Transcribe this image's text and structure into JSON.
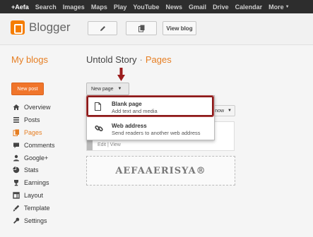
{
  "gbar": {
    "items": [
      "+Aefa",
      "Search",
      "Images",
      "Maps",
      "Play",
      "YouTube",
      "News",
      "Gmail",
      "Drive",
      "Calendar"
    ],
    "more": "More"
  },
  "header": {
    "logo_text": "Blogger",
    "view_blog": "View blog"
  },
  "sidebar": {
    "title": "My blogs",
    "new_post": "New post",
    "items": [
      {
        "label": "Overview",
        "icon": "overview-icon"
      },
      {
        "label": "Posts",
        "icon": "posts-icon"
      },
      {
        "label": "Pages",
        "icon": "pages-icon",
        "active": true
      },
      {
        "label": "Comments",
        "icon": "comments-icon"
      },
      {
        "label": "Google+",
        "icon": "google-plus-icon"
      },
      {
        "label": "Stats",
        "icon": "stats-icon"
      },
      {
        "label": "Earnings",
        "icon": "earnings-icon"
      },
      {
        "label": "Layout",
        "icon": "layout-icon"
      },
      {
        "label": "Template",
        "icon": "template-icon"
      },
      {
        "label": "Settings",
        "icon": "settings-icon"
      }
    ]
  },
  "main": {
    "blog_name": "Untold Story",
    "separator": "·",
    "current": "Pages",
    "new_page": "New page",
    "show_label": "now",
    "page_links": "Edit | View",
    "gadget_text": "AEFAAERISYA®"
  },
  "dropdown": {
    "items": [
      {
        "title": "Blank page",
        "subtitle": "Add text and media"
      },
      {
        "title": "Web address",
        "subtitle": "Send readers to another web address"
      }
    ]
  },
  "colors": {
    "accent": "#e67e22",
    "highlight": "#8b1a1a",
    "topbar": "#2d2d2d"
  }
}
